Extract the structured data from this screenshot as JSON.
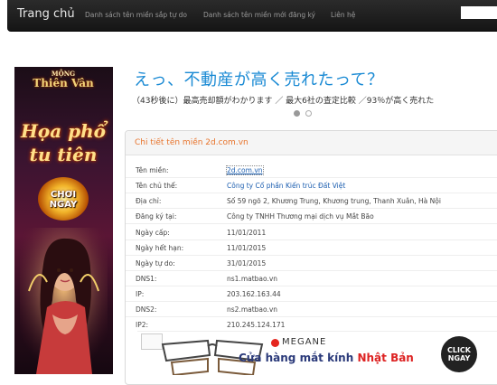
{
  "navbar": {
    "brand": "Trang chủ",
    "links": [
      "Danh sách tên miền sắp tự do",
      "Danh sách tên miền mới đăng ký",
      "Liên hệ"
    ],
    "search_value": ""
  },
  "left_ad": {
    "logo_line1": "MỘNG",
    "logo_line2": "Thiên Vân",
    "title_line1": "Họa phổ",
    "title_line2": "tu tiên",
    "play_line1": "CHƠI",
    "play_line2": "NGAY"
  },
  "top_ad": {
    "headline": "えっ、不動産が高く売れたって？",
    "subline": "（43秒後に）最高売却額がわかります ／ 最大6社の査定比較 ／93％が高く売れた",
    "slides": 2,
    "active_slide": 1
  },
  "detail": {
    "title": "Chi tiết tên miền 2d.com.vn",
    "rows": [
      {
        "label": "Tên miền:",
        "value": "2d.com.vn"
      },
      {
        "label": "Tên chủ thể:",
        "value": "Công ty Cổ phần Kiến trúc Đất Việt"
      },
      {
        "label": "Địa chỉ:",
        "value": "Số 59 ngõ 2, Khương Trung, Khương trung, Thanh Xuân, Hà Nội"
      },
      {
        "label": "Đăng ký tại:",
        "value": "Công ty TNHH Thương mại dịch vụ Mắt Bão"
      },
      {
        "label": "Ngày cấp:",
        "value": "11/01/2011"
      },
      {
        "label": "Ngày hết hạn:",
        "value": "11/01/2015"
      },
      {
        "label": "Ngày tự do:",
        "value": "31/01/2015"
      },
      {
        "label": "DNS1:",
        "value": "ns1.matbao.vn"
      },
      {
        "label": "IP:",
        "value": "203.162.163.44"
      },
      {
        "label": "DNS2:",
        "value": "ns2.matbao.vn"
      },
      {
        "label": "IP2:",
        "value": "210.245.124.171"
      }
    ]
  },
  "bottom_ad": {
    "brand": "MEGANE",
    "text_prefix": "Cửa hàng mắt kính",
    "text_highlight": "Nhật Bản",
    "cta_line1": "CLICK",
    "cta_line2": "NGAY"
  },
  "colors": {
    "navbar_bg": "#1e1e1e",
    "panel_title": "#e8742c",
    "link": "#1d5fb0",
    "top_ad_headline": "#1a8ad4"
  }
}
